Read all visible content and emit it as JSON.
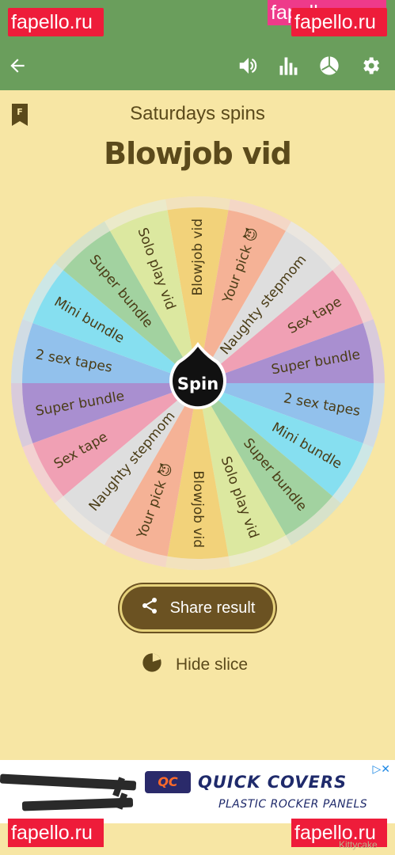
{
  "status_bar": {
    "time": "..."
  },
  "watermarks": {
    "top_left": "fapello.ru",
    "top_pink": "fapello.ru",
    "top_right": "fapello.ru",
    "bottom_left": "fapello.ru",
    "bottom_right": "fapello.ru"
  },
  "app_bar": {
    "icons": [
      "back-arrow-icon",
      "volume-icon",
      "stats-icon",
      "pie-chart-icon",
      "gear-icon"
    ]
  },
  "header": {
    "subtitle": "Saturdays spins",
    "result_title": "Blowjob vid"
  },
  "wheel": {
    "center_label": "Spin",
    "colors": [
      "#f2d27a",
      "#f5b296",
      "#dedede",
      "#f0a0b4",
      "#a98fd0",
      "#92c1ec",
      "#86dff0",
      "#a2d2a0",
      "#dce8a0"
    ],
    "slices": [
      {
        "label": "Blowjob vid",
        "emoji": ""
      },
      {
        "label": "Your pick",
        "emoji": "😈"
      },
      {
        "label": "Naughty stepmom",
        "emoji": ""
      },
      {
        "label": "Sex tape",
        "emoji": ""
      },
      {
        "label": "Super bundle",
        "emoji": ""
      },
      {
        "label": "2 sex tapes",
        "emoji": ""
      },
      {
        "label": "Mini bundle",
        "emoji": ""
      },
      {
        "label": "Super bundle",
        "emoji": ""
      },
      {
        "label": "Solo play vid",
        "emoji": ""
      },
      {
        "label": "Blowjob vid",
        "emoji": ""
      },
      {
        "label": "Your pick",
        "emoji": "😈"
      },
      {
        "label": "Naughty stepmom",
        "emoji": ""
      },
      {
        "label": "Sex tape",
        "emoji": ""
      },
      {
        "label": "Super bundle",
        "emoji": ""
      },
      {
        "label": "2 sex tapes",
        "emoji": ""
      },
      {
        "label": "Mini bundle",
        "emoji": ""
      },
      {
        "label": "Super bundle",
        "emoji": ""
      },
      {
        "label": "Solo play vid",
        "emoji": ""
      }
    ]
  },
  "actions": {
    "share_label": "Share result",
    "hide_slice_label": "Hide slice"
  },
  "ad": {
    "logo_text": "QC",
    "headline": "QUICK COVERS",
    "subline": "PLASTIC ROCKER PANELS",
    "adchoices": "▷✕"
  },
  "credit": "Kittycake"
}
